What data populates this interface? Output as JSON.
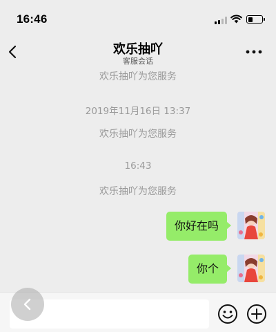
{
  "status_bar": {
    "time": "16:46",
    "battery_level": 0.35
  },
  "nav": {
    "title": "欢乐抽吖",
    "subtitle": "客服会话",
    "icons": [
      "back-icon",
      "more-icon"
    ]
  },
  "messages": [
    {
      "type": "system",
      "text": "欢乐抽吖为您服务"
    },
    {
      "type": "timestamp",
      "text": "2019年11月16日 13:37"
    },
    {
      "type": "system",
      "text": "欢乐抽吖为您服务"
    },
    {
      "type": "timestamp",
      "text": "16:43"
    },
    {
      "type": "system",
      "text": "欢乐抽吖为您服务"
    },
    {
      "type": "outgoing",
      "text": "你好在吗"
    },
    {
      "type": "outgoing",
      "text": "你个"
    }
  ],
  "input_bar": {
    "input_value": "",
    "icons": [
      "emoji-icon",
      "plus-icon",
      "floating-back-icon"
    ]
  },
  "colors": {
    "background": "#ededed",
    "bubble": "#95ec69",
    "system_text": "#999999"
  }
}
